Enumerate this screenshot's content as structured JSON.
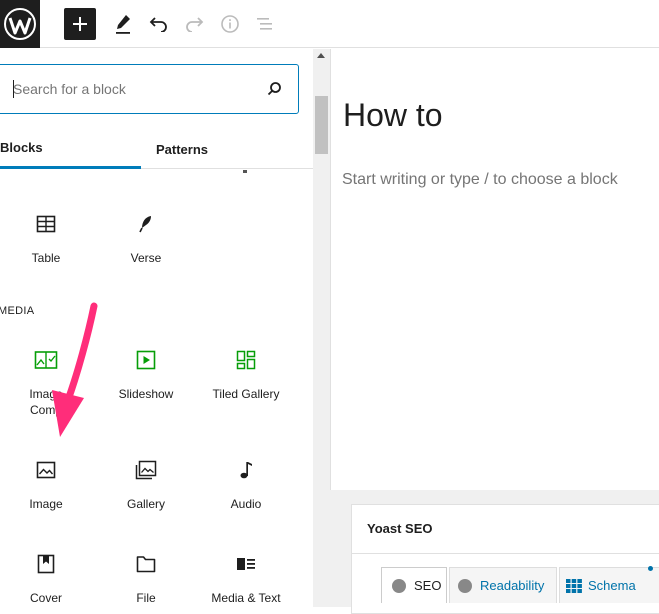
{
  "toolbar": {
    "logo_icon": "wordpress-logo-icon",
    "add_icon": "plus-icon",
    "tools_icon": "pencil-icon",
    "undo_icon": "undo-icon",
    "redo_icon": "redo-icon",
    "details_icon": "info-icon",
    "outline_icon": "list-view-icon"
  },
  "inserter": {
    "search": {
      "placeholder": "Search for a block",
      "icon": "search-icon"
    },
    "tabs": [
      {
        "label": "Blocks",
        "active": true
      },
      {
        "label": "Patterns",
        "active": false
      }
    ],
    "text_blocks": [
      {
        "label": "Table",
        "icon": "table-icon"
      },
      {
        "label": "Verse",
        "icon": "feather-icon"
      }
    ],
    "media_category": "MEDIA",
    "media_blocks": [
      {
        "label": "Image Comp",
        "label_line1": "Image",
        "label_line2": "Comp",
        "icon": "image-compare-icon",
        "color": "#069e08"
      },
      {
        "label": "Slideshow",
        "icon": "slideshow-icon",
        "color": "#069e08"
      },
      {
        "label": "Tiled Gallery",
        "icon": "tiled-gallery-icon",
        "color": "#069e08"
      },
      {
        "label": "Image",
        "icon": "image-icon"
      },
      {
        "label": "Gallery",
        "icon": "gallery-icon"
      },
      {
        "label": "Audio",
        "icon": "music-note-icon"
      },
      {
        "label": "Cover",
        "icon": "cover-icon"
      },
      {
        "label": "File",
        "icon": "folder-icon"
      },
      {
        "label": "Media & Text",
        "icon": "media-text-icon"
      }
    ]
  },
  "editor": {
    "title": "How to",
    "placeholder": "Start writing or type / to choose a block"
  },
  "yoast": {
    "title": "Yoast SEO",
    "tabs": [
      {
        "label": "SEO",
        "icon": "status-dot-icon"
      },
      {
        "label": "Readability",
        "icon": "status-dot-icon"
      },
      {
        "label": "Schema",
        "icon": "grid-icon"
      }
    ]
  },
  "colors": {
    "accent": "#007cba",
    "jetpack_green": "#069e08",
    "annotation_arrow": "#ff2d7a",
    "yoast_link": "#0073aa"
  }
}
